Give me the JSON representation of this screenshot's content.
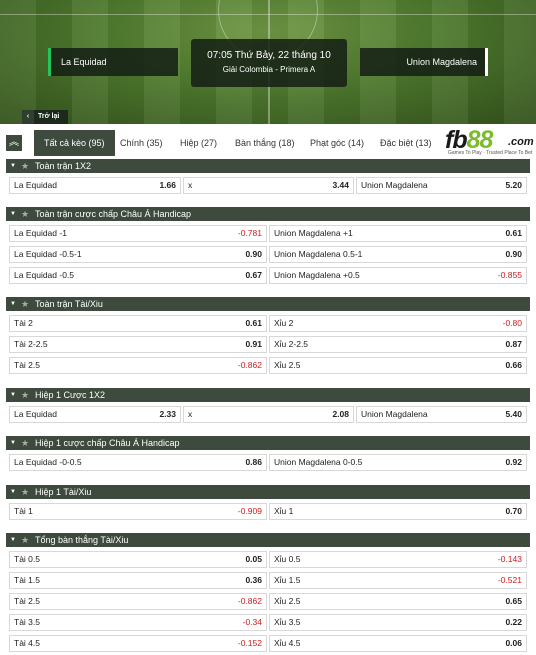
{
  "header": {
    "home_team": "La Equidad",
    "away_team": "Union Magdalena",
    "datetime": "07:05 Thứ Bảy, 22 tháng 10",
    "league": "Giải Colombia - Primera A",
    "back_label": "Trở lại",
    "back_icon": "chevron-left-icon"
  },
  "tabs": [
    {
      "label": "Tất cả kèo (95)",
      "active": true
    },
    {
      "label": "Chính (35)"
    },
    {
      "label": "Hiệp (27)"
    },
    {
      "label": "Bàn thắng (18)"
    },
    {
      "label": "Phạt góc (14)"
    },
    {
      "label": "Đặc biệt (13)"
    }
  ],
  "logo": {
    "fb": "fb",
    "num": "88",
    "com": ".com",
    "tagline": "Games To Play · Trusted Place To Bet"
  },
  "sections": [
    {
      "title": "Toàn trận 1X2",
      "rows": [
        [
          {
            "label": "La Equidad",
            "odd": "1.66"
          },
          {
            "label": "x",
            "odd": "3.44"
          },
          {
            "label": "Union Magdalena",
            "odd": "5.20"
          }
        ]
      ]
    },
    {
      "title": "Toàn trận cược chấp Châu Á Handicap",
      "rows": [
        [
          {
            "label": "La Equidad",
            "line": "-1",
            "odd": "-0.781"
          },
          {
            "label": "Union Magdalena",
            "line": "+1",
            "odd": "0.61"
          }
        ],
        [
          {
            "label": "La Equidad",
            "line": "-0.5-1",
            "odd": "0.90"
          },
          {
            "label": "Union Magdalena",
            "line": "0.5-1",
            "odd": "0.90"
          }
        ],
        [
          {
            "label": "La Equidad",
            "line": "-0.5",
            "odd": "0.67"
          },
          {
            "label": "Union Magdalena",
            "line": "+0.5",
            "odd": "-0.855"
          }
        ]
      ]
    },
    {
      "title": "Toàn trận Tài/Xiu",
      "rows": [
        [
          {
            "label": "Tài",
            "line": "2",
            "odd": "0.61"
          },
          {
            "label": "Xỉu",
            "line": "2",
            "odd": "-0.80"
          }
        ],
        [
          {
            "label": "Tài",
            "line": "2-2.5",
            "odd": "0.91"
          },
          {
            "label": "Xỉu",
            "line": "2-2.5",
            "odd": "0.87"
          }
        ],
        [
          {
            "label": "Tài",
            "line": "2.5",
            "odd": "-0.862"
          },
          {
            "label": "Xỉu",
            "line": "2.5",
            "odd": "0.66"
          }
        ]
      ]
    },
    {
      "title": "Hiệp 1 Cược 1X2",
      "rows": [
        [
          {
            "label": "La Equidad",
            "odd": "2.33"
          },
          {
            "label": "x",
            "odd": "2.08"
          },
          {
            "label": "Union Magdalena",
            "odd": "5.40"
          }
        ]
      ]
    },
    {
      "title": "Hiệp 1 cược chấp Châu Á Handicap",
      "rows": [
        [
          {
            "label": "La Equidad",
            "line": "-0-0.5",
            "odd": "0.86"
          },
          {
            "label": "Union Magdalena",
            "line": "0-0.5",
            "odd": "0.92"
          }
        ]
      ]
    },
    {
      "title": "Hiệp 1 Tài/Xiu",
      "rows": [
        [
          {
            "label": "Tài",
            "line": "1",
            "odd": "-0.909"
          },
          {
            "label": "Xỉu",
            "line": "1",
            "odd": "0.70"
          }
        ]
      ]
    },
    {
      "title": "Tổng bàn thắng Tài/Xiu",
      "rows": [
        [
          {
            "label": "Tài",
            "line": "0.5",
            "odd": "0.05"
          },
          {
            "label": "Xỉu",
            "line": "0.5",
            "odd": "-0.143"
          }
        ],
        [
          {
            "label": "Tài",
            "line": "1.5",
            "odd": "0.36"
          },
          {
            "label": "Xỉu",
            "line": "1.5",
            "odd": "-0.521"
          }
        ],
        [
          {
            "label": "Tài",
            "line": "2.5",
            "odd": "-0.862"
          },
          {
            "label": "Xỉu",
            "line": "2.5",
            "odd": "0.65"
          }
        ],
        [
          {
            "label": "Tài",
            "line": "3.5",
            "odd": "-0.34"
          },
          {
            "label": "Xỉu",
            "line": "3.5",
            "odd": "0.22"
          }
        ],
        [
          {
            "label": "Tài",
            "line": "4.5",
            "odd": "-0.152"
          },
          {
            "label": "Xỉu",
            "line": "4.5",
            "odd": "0.06"
          }
        ]
      ]
    }
  ],
  "colors": {
    "negative": "#d01b1b",
    "header_bar": "#3d4a3d",
    "accent": "#22c55e"
  }
}
